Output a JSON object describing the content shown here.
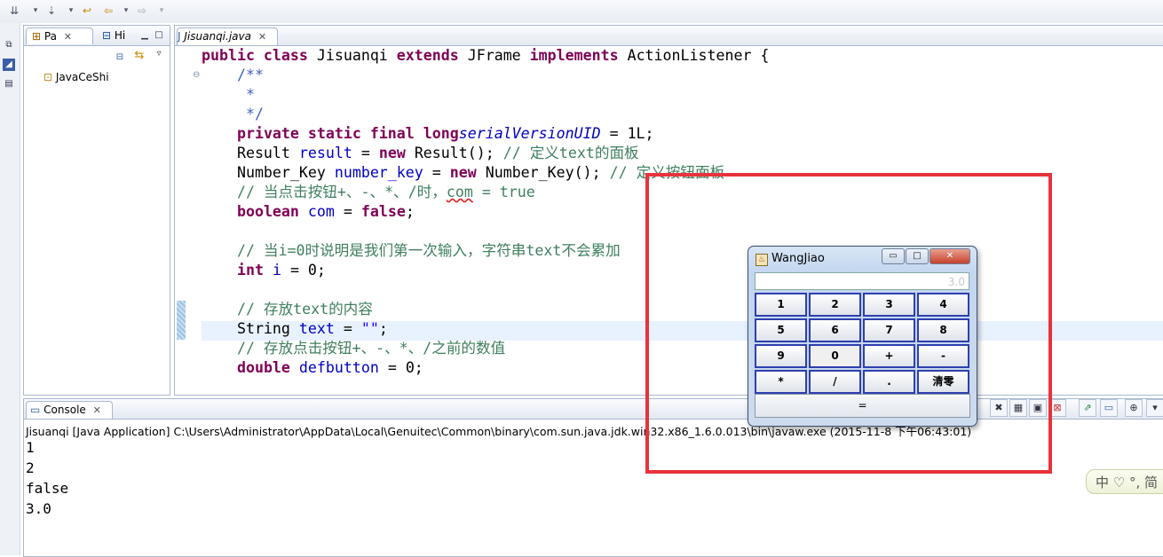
{
  "toolbar": {
    "icons": [
      "debug-icon",
      "run-icon",
      "back-icon",
      "forward-icon"
    ]
  },
  "package_explorer": {
    "tab_label": "Pa",
    "tab2_label": "Hi",
    "close_glyph": "✕",
    "project": "JavaCeShi"
  },
  "editor": {
    "tab_label": "Jisuanqi.java",
    "lines": [
      {
        "kind": "class",
        "parts": [
          "public class",
          "Jisuanqi",
          "extends",
          "JFrame",
          "implements",
          "ActionListener {"
        ]
      },
      {
        "kind": "doc",
        "text": "    /**"
      },
      {
        "kind": "doc",
        "text": "     *"
      },
      {
        "kind": "doc",
        "text": "     */"
      },
      {
        "kind": "field",
        "parts": [
          "    ",
          "private static final long",
          "serialVersionUID",
          " = 1L;"
        ]
      },
      {
        "kind": "decl",
        "parts": [
          "    Result ",
          "result",
          " = ",
          "new",
          " Result(); ",
          "// 定义text的面板"
        ]
      },
      {
        "kind": "decl",
        "parts": [
          "    Number_Key ",
          "number_key",
          " = ",
          "new",
          " Number_Key(); ",
          "// 定义按钮面板"
        ]
      },
      {
        "kind": "comment2",
        "parts": [
          "    // 当点击按钮+、-、*、/时，",
          "com",
          " = true"
        ]
      },
      {
        "kind": "bool",
        "parts": [
          "    ",
          "boolean",
          " ",
          "com",
          " = ",
          "false",
          ";"
        ]
      },
      {
        "kind": "blank",
        "text": ""
      },
      {
        "kind": "comment",
        "text": "    // 当i=0时说明是我们第一次输入，字符串text不会累加"
      },
      {
        "kind": "int",
        "parts": [
          "    ",
          "int",
          " ",
          "i",
          " = 0;"
        ]
      },
      {
        "kind": "blank",
        "text": ""
      },
      {
        "kind": "comment",
        "text": "    // 存放text的内容"
      },
      {
        "kind": "string",
        "parts": [
          "    String ",
          "text",
          " = ",
          "\"\"",
          ";"
        ]
      },
      {
        "kind": "comment",
        "text": "    // 存放点击按钮+、-、*、/之前的数值"
      },
      {
        "kind": "double",
        "parts": [
          "    ",
          "double",
          " ",
          "defbutton",
          " = 0;"
        ]
      }
    ]
  },
  "console": {
    "tab_label": "Console",
    "launch_path": "Jisuanqi [Java Application] C:\\Users\\Administrator\\AppData\\Local\\Genuitec\\Common\\binary\\com.sun.java.jdk.win32.x86_1.6.0.013\\bin\\javaw.exe (2015-11-8 下午06:43:01)",
    "output": [
      "1",
      "2",
      "false",
      "3.0"
    ]
  },
  "calculator": {
    "title": "WangJiao",
    "display": "3.0",
    "keys": [
      [
        "1",
        "2",
        "3",
        "4"
      ],
      [
        "5",
        "6",
        "7",
        "8"
      ],
      [
        "9",
        "0",
        "+",
        "-"
      ],
      [
        "*",
        "/",
        ".",
        "清零"
      ]
    ],
    "equals": "=",
    "win_buttons": {
      "minimize": "▭",
      "maximize": "□",
      "close": "✕"
    }
  },
  "ime": {
    "text": "中 ♡ °, 简"
  },
  "colors": {
    "highlight_box": "#e8323c",
    "keyword": "#7f0055",
    "field": "#0000c0",
    "comment": "#3f7f5f"
  }
}
